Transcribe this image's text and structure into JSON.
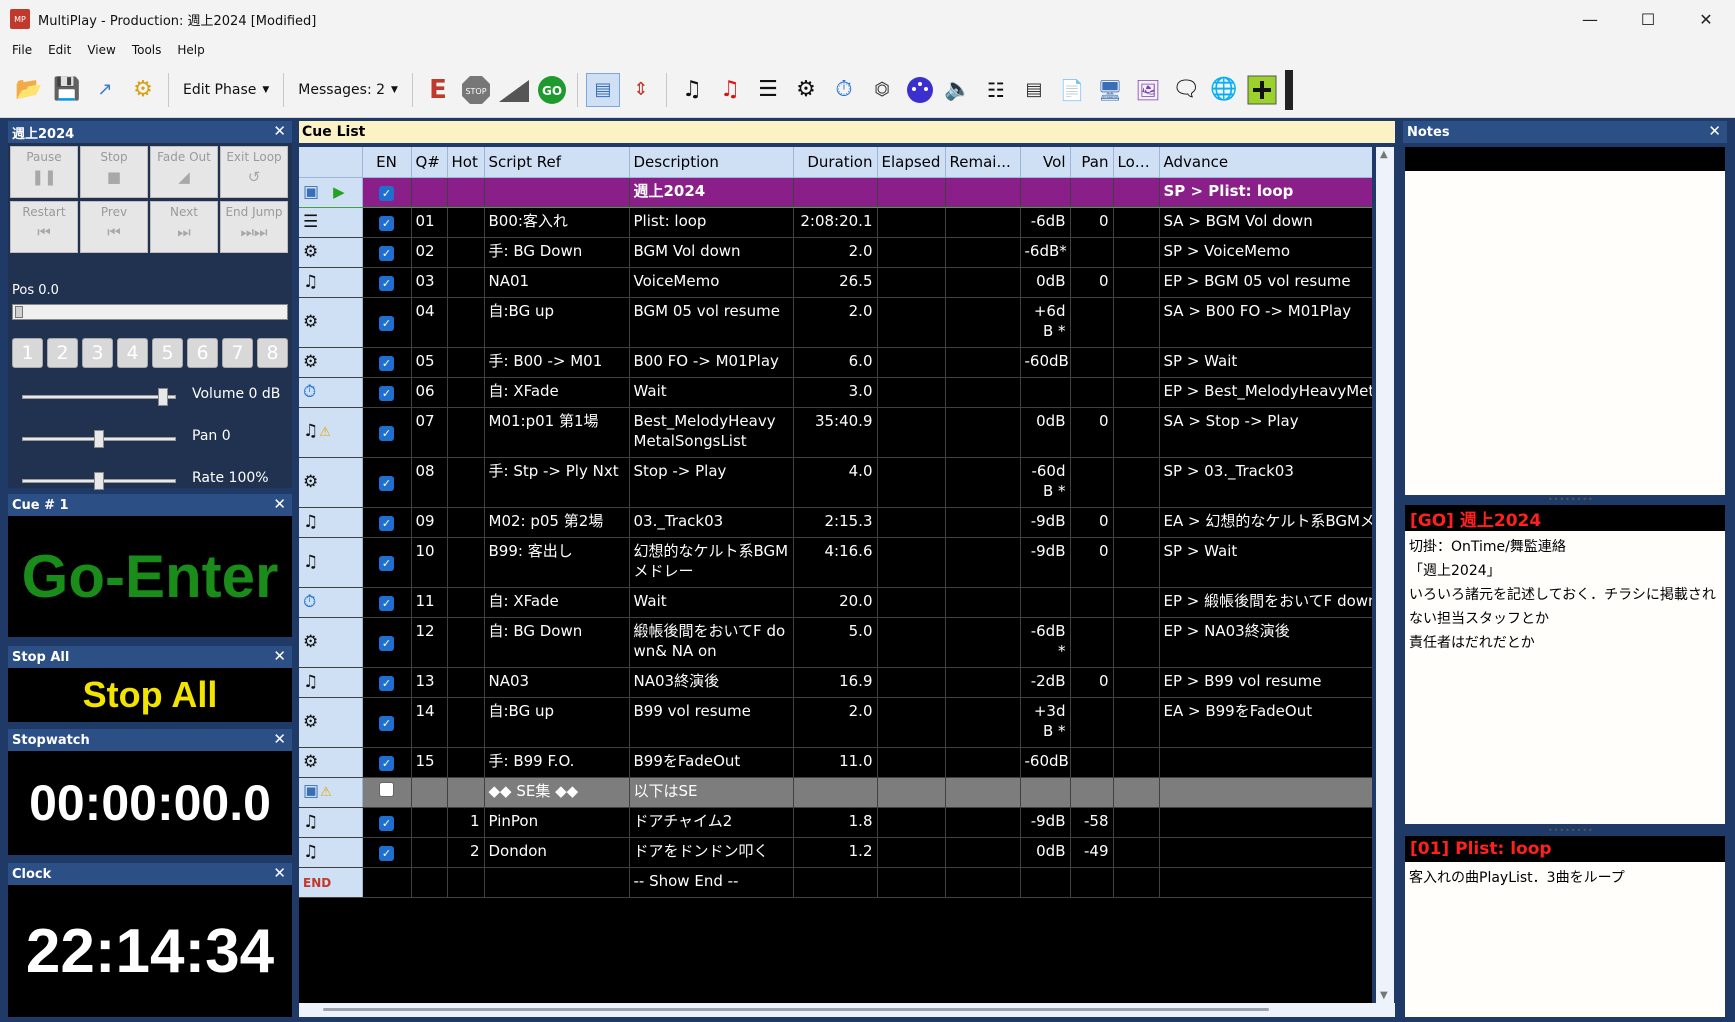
{
  "window": {
    "title": "MultiPlay - Production: 週上2024 [Modified]",
    "app_icon": "MP"
  },
  "menu": [
    "File",
    "Edit",
    "View",
    "Tools",
    "Help"
  ],
  "toolbar": {
    "edit_phase": "Edit Phase",
    "messages": "Messages: 2"
  },
  "transport": {
    "title": "週上2024",
    "buttons": {
      "pause": "Pause",
      "stop": "Stop",
      "fade_out": "Fade Out",
      "exit_loop": "Exit Loop",
      "restart": "Restart",
      "prev": "Prev",
      "next": "Next",
      "end_jump": "End Jump"
    },
    "pos": "Pos 0.0",
    "numbers": [
      "1",
      "2",
      "3",
      "4",
      "5",
      "6",
      "7",
      "8"
    ],
    "volume": "Volume 0 dB",
    "pan": "Pan 0",
    "rate": "Rate 100%",
    "volume_level": 0.95,
    "pan_level": 0.5,
    "rate_level": 0.5
  },
  "cue_panel": {
    "title": "Cue # 1",
    "text": "Go-Enter"
  },
  "stopall_panel": {
    "title": "Stop All",
    "text": "Stop All"
  },
  "stopwatch_panel": {
    "title": "Stopwatch",
    "text": "00:00:00.0"
  },
  "clock_panel": {
    "title": "Clock",
    "text": "22:14:34"
  },
  "cuelist": {
    "title": "Cue List",
    "columns": [
      "EN",
      "Q#",
      "Hot",
      "Script Ref",
      "Description",
      "Duration",
      "Elapsed",
      "Remai...",
      "Vol",
      "Pan",
      "Loo...",
      "Advance"
    ],
    "rows": [
      {
        "icon": "playlist-icon",
        "en": true,
        "q": "",
        "hot": "",
        "script": "",
        "desc": "週上2024",
        "dur": "",
        "vol": "",
        "pan": "",
        "adv": "SP > Plist: loop",
        "kind": "sel"
      },
      {
        "icon": "list-icon",
        "en": true,
        "q": "01",
        "hot": "",
        "script": "B00:客入れ",
        "desc": "Plist: loop",
        "dur": "2:08:20.1",
        "vol": "-6dB",
        "pan": "0",
        "adv": "SA > BGM Vol down"
      },
      {
        "icon": "gears-icon",
        "en": true,
        "q": "02",
        "hot": "",
        "script": "手: BG Down",
        "desc": "BGM Vol down",
        "dur": "2.0",
        "vol": "-6dB*",
        "pan": "",
        "adv": "SP > VoiceMemo"
      },
      {
        "icon": "note-icon",
        "en": true,
        "q": "03",
        "hot": "",
        "script": "NA01",
        "desc": "VoiceMemo",
        "dur": "26.5",
        "vol": "0dB",
        "pan": "0",
        "adv": "EP > BGM 05 vol resume"
      },
      {
        "icon": "gears-icon",
        "en": true,
        "q": "04",
        "hot": "",
        "script": "自:BG up",
        "desc": "BGM 05 vol resume",
        "dur": "2.0",
        "vol": "+6dB *",
        "pan": "",
        "adv": "SA > B00 FO -> M01Play",
        "tall": true
      },
      {
        "icon": "gears-icon",
        "en": true,
        "q": "05",
        "hot": "",
        "script": "手: B00 -> M01",
        "desc": "B00 FO -> M01Play",
        "dur": "6.0",
        "vol": "-60dB",
        "pan": "",
        "adv": "SP > Wait"
      },
      {
        "icon": "timer-icon",
        "en": true,
        "q": "06",
        "hot": "",
        "script": "自: XFade",
        "desc": "Wait",
        "dur": "3.0",
        "vol": "",
        "pan": "",
        "adv": "EP > Best_MelodyHeavyMetalSongsList"
      },
      {
        "icon": "note-warn-icon",
        "en": true,
        "q": "07",
        "hot": "",
        "script": "M01:p01 第1場",
        "desc": "Best_MelodyHeavyMetalSongsList",
        "dur": "35:40.9",
        "vol": "0dB",
        "pan": "0",
        "adv": "SA > Stop -> Play",
        "tall": true
      },
      {
        "icon": "gears-icon",
        "en": true,
        "q": "08",
        "hot": "",
        "script": "手: Stp -> Ply Nxt",
        "desc": "Stop -> Play",
        "dur": "4.0",
        "vol": "-60dB *",
        "pan": "",
        "adv": "SP > 03._Track03",
        "tall": true
      },
      {
        "icon": "note-icon",
        "en": true,
        "q": "09",
        "hot": "",
        "script": "M02: p05 第2場",
        "desc": "03._Track03",
        "dur": "2:15.3",
        "vol": "-9dB",
        "pan": "0",
        "adv": "EA > 幻想的なケルト系BGMメドレー"
      },
      {
        "icon": "note-icon",
        "en": true,
        "q": "10",
        "hot": "",
        "script": "B99: 客出し",
        "desc": "幻想的なケルト系BGMメドレー",
        "dur": "4:16.6",
        "vol": "-9dB",
        "pan": "0",
        "adv": "SP > Wait",
        "tall": true
      },
      {
        "icon": "timer-icon",
        "en": true,
        "q": "11",
        "hot": "",
        "script": "自: XFade",
        "desc": "Wait",
        "dur": "20.0",
        "vol": "",
        "pan": "",
        "adv": "EP > 緞帳後間をおいてF down& NA on"
      },
      {
        "icon": "gears-icon",
        "en": true,
        "q": "12",
        "hot": "",
        "script": "自: BG Down",
        "desc": "緞帳後間をおいてF down& NA on",
        "dur": "5.0",
        "vol": "-6dB*",
        "pan": "",
        "adv": "EP > NA03終演後",
        "tall": true
      },
      {
        "icon": "note-icon",
        "en": true,
        "q": "13",
        "hot": "",
        "script": "NA03",
        "desc": "NA03終演後",
        "dur": "16.9",
        "vol": "-2dB",
        "pan": "0",
        "adv": "EP > B99 vol resume"
      },
      {
        "icon": "gears-icon",
        "en": true,
        "q": "14",
        "hot": "",
        "script": "自:BG up",
        "desc": "B99 vol resume",
        "dur": "2.0",
        "vol": "+3dB *",
        "pan": "",
        "adv": "EA > B99をFadeOut",
        "tall": true
      },
      {
        "icon": "gears-icon",
        "en": true,
        "q": "15",
        "hot": "",
        "script": "手: B99 F.O.",
        "desc": "B99をFadeOut",
        "dur": "11.0",
        "vol": "-60dB",
        "pan": "",
        "adv": ""
      },
      {
        "icon": "playlist-warn-icon",
        "en": false,
        "q": "",
        "hot": "",
        "script": "◆◆ SE集 ◆◆",
        "desc": "以下はSE",
        "dur": "",
        "vol": "",
        "pan": "",
        "adv": "",
        "kind": "grey"
      },
      {
        "icon": "note-icon",
        "en": true,
        "q": "",
        "hot": "1",
        "script": "PinPon",
        "desc": "ドアチャイム2",
        "dur": "1.8",
        "vol": "-9dB",
        "pan": "-58",
        "adv": ""
      },
      {
        "icon": "note-icon",
        "en": true,
        "q": "",
        "hot": "2",
        "script": "Dondon",
        "desc": "ドアをドンドン叩く",
        "dur": "1.2",
        "vol": "0dB",
        "pan": "-49",
        "adv": ""
      },
      {
        "icon": "end-icon",
        "en": null,
        "q": "",
        "hot": "",
        "script": "",
        "desc": "-- Show End --",
        "dur": "",
        "vol": "",
        "pan": "",
        "adv": ""
      }
    ]
  },
  "notes": {
    "title": "Notes",
    "go_title": "[GO] 週上2024",
    "go_text": "切掛：OnTime/舞監連絡\n「週上2024」\nいろいろ諸元を記述しておく．チラシに掲載されない担当スタッフとか\n責任者はだれだとか",
    "cue_title": "[01] Plist: loop",
    "cue_text": "客入れの曲PlayList．3曲をループ"
  }
}
